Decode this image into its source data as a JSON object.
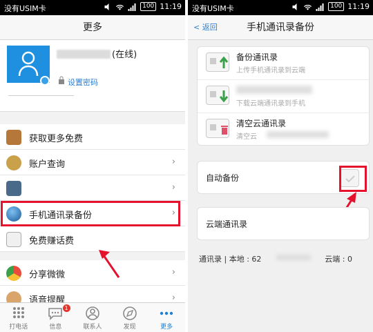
{
  "status": {
    "carrier": "没有USIM卡",
    "time": "11:19",
    "battery": "100"
  },
  "left": {
    "title": "更多",
    "profile": {
      "status": "(在线)",
      "set_password": "设置密码"
    },
    "menu": [
      {
        "label": "获取更多免费",
        "icon": "treasure-chest-icon",
        "chevron": false
      },
      {
        "label": "账户查询",
        "icon": "money-bag-icon",
        "chevron": true
      },
      {
        "label": "",
        "icon": "app-icon",
        "chevron": true
      },
      {
        "label": "手机通讯录备份",
        "icon": "globe-icon",
        "chevron": true
      },
      {
        "label": "免费赚话费",
        "icon": "notepad-icon",
        "chevron": false
      },
      {
        "label": "分享微微",
        "icon": "share-icon",
        "chevron": true
      },
      {
        "label": "语音提醒",
        "icon": "voice-icon",
        "chevron": true
      }
    ],
    "tabs": [
      {
        "label": "打电话",
        "icon": "dialpad-icon"
      },
      {
        "label": "信息",
        "icon": "message-icon",
        "badge": "1"
      },
      {
        "label": "联系人",
        "icon": "contacts-icon"
      },
      {
        "label": "发现",
        "icon": "compass-icon"
      },
      {
        "label": "更多",
        "icon": "more-icon"
      }
    ],
    "chevron": "›",
    "colors": {
      "accent": "#1f7fd5",
      "highlight": "#e4122c"
    }
  },
  "right": {
    "back": "< 返回",
    "title": "手机通讯录备份",
    "rows": [
      {
        "title": "备份通讯录",
        "sub": "上传手机通讯录到云端"
      },
      {
        "title": "",
        "sub": "下载云端通讯录到手机"
      },
      {
        "title": "清空云通讯录",
        "sub": "清空云"
      }
    ],
    "auto_backup": "自动备份",
    "cloud_contacts": "云端通讯录",
    "footer": {
      "local": "通讯录 | 本地 : 62",
      "cloud": "云端 : 0"
    }
  }
}
